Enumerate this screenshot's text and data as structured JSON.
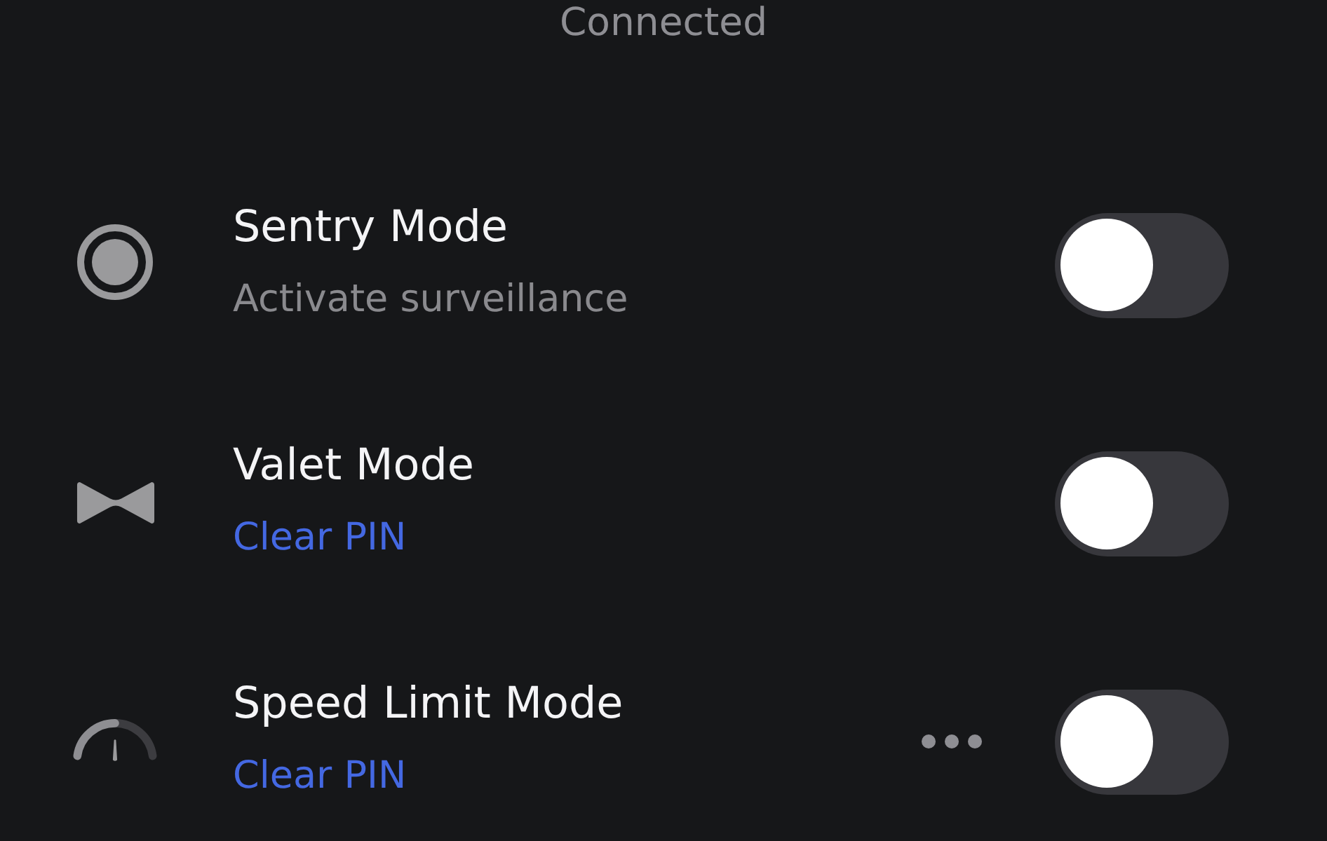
{
  "status": "Connected",
  "settings": [
    {
      "title": "Sentry Mode",
      "subtitle": {
        "kind": "text",
        "text": "Activate surveillance"
      },
      "menu": false,
      "on": false
    },
    {
      "title": "Valet Mode",
      "subtitle": {
        "kind": "link",
        "text": "Clear PIN"
      },
      "menu": false,
      "on": false
    },
    {
      "title": "Speed Limit Mode",
      "subtitle": {
        "kind": "link",
        "text": "Clear PIN"
      },
      "menu": true,
      "on": false
    }
  ]
}
